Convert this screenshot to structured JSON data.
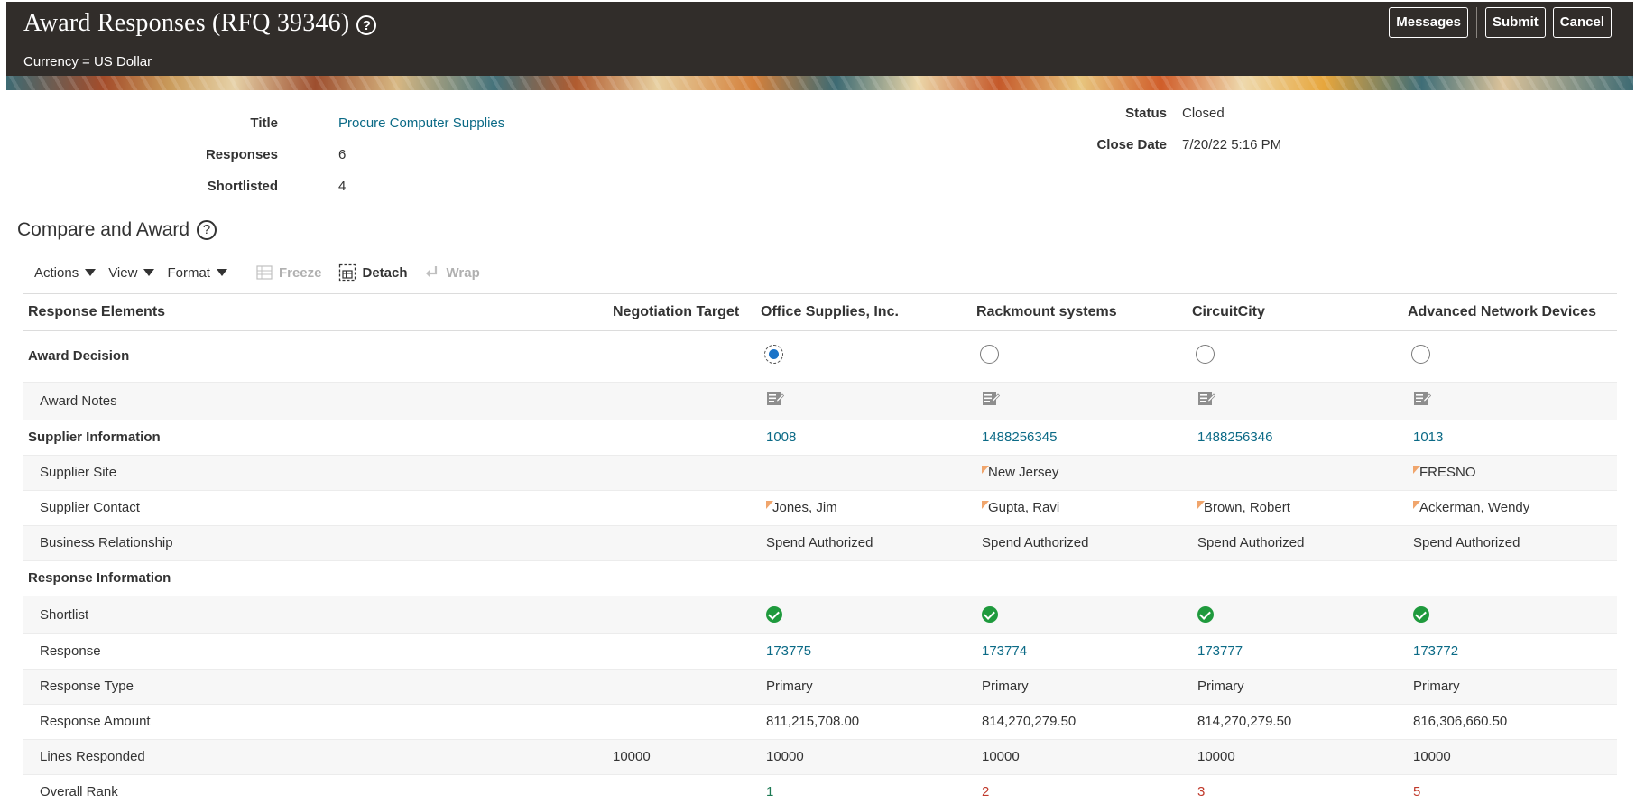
{
  "header": {
    "title": "Award Responses (RFQ 39346)",
    "currency": "Currency = US Dollar",
    "buttons": {
      "messages": "Messages",
      "submit": "Submit",
      "cancel": "Cancel"
    }
  },
  "summary": {
    "title_label": "Title",
    "title_value": "Procure Computer Supplies",
    "responses_label": "Responses",
    "responses_value": "6",
    "shortlisted_label": "Shortlisted",
    "shortlisted_value": "4",
    "status_label": "Status",
    "status_value": "Closed",
    "close_date_label": "Close Date",
    "close_date_value": "7/20/22 5:16 PM"
  },
  "section": {
    "title": "Compare and Award"
  },
  "toolbar": {
    "actions": "Actions",
    "view": "View",
    "format": "Format",
    "freeze": "Freeze",
    "detach": "Detach",
    "wrap": "Wrap"
  },
  "table": {
    "headers": {
      "elements": "Response Elements",
      "target": "Negotiation Target",
      "suppliers": [
        "Office Supplies, Inc.",
        "Rackmount systems",
        "CircuitCity",
        "Advanced Network Devices"
      ]
    },
    "award_decision": {
      "label": "Award Decision",
      "selected_index": 0
    },
    "award_notes": {
      "label": "Award Notes"
    },
    "supplier_information": {
      "label": "Supplier Information",
      "values": [
        "1008",
        "1488256345",
        "1488256346",
        "1013"
      ]
    },
    "supplier_site": {
      "label": "Supplier Site",
      "values": [
        "",
        "New Jersey",
        "",
        "FRESNO"
      ]
    },
    "supplier_contact": {
      "label": "Supplier Contact",
      "values": [
        "Jones, Jim",
        "Gupta, Ravi",
        "Brown, Robert",
        "Ackerman, Wendy"
      ]
    },
    "business_relationship": {
      "label": "Business Relationship",
      "values": [
        "Spend Authorized",
        "Spend Authorized",
        "Spend Authorized",
        "Spend Authorized"
      ]
    },
    "response_information": {
      "label": "Response Information"
    },
    "shortlist": {
      "label": "Shortlist",
      "values": [
        true,
        true,
        true,
        true
      ]
    },
    "response": {
      "label": "Response",
      "values": [
        "173775",
        "173774",
        "173777",
        "173772"
      ]
    },
    "response_type": {
      "label": "Response Type",
      "values": [
        "Primary",
        "Primary",
        "Primary",
        "Primary"
      ]
    },
    "response_amount": {
      "label": "Response Amount",
      "values": [
        "811,215,708.00",
        "814,270,279.50",
        "814,270,279.50",
        "816,306,660.50"
      ]
    },
    "lines_responded": {
      "label": "Lines Responded",
      "target": "10000",
      "values": [
        "10000",
        "10000",
        "10000",
        "10000"
      ]
    },
    "overall_rank": {
      "label": "Overall Rank",
      "values": [
        "1",
        "2",
        "3",
        "5"
      ]
    }
  },
  "colors": {
    "header_bg": "#312d2a",
    "link": "#0b6a86",
    "radio_selected": "#1a73c8",
    "check": "#1f9a3d",
    "rank_best": "#1d7a54",
    "rank_other": "#c0392b",
    "flag": "#f0a56c"
  }
}
